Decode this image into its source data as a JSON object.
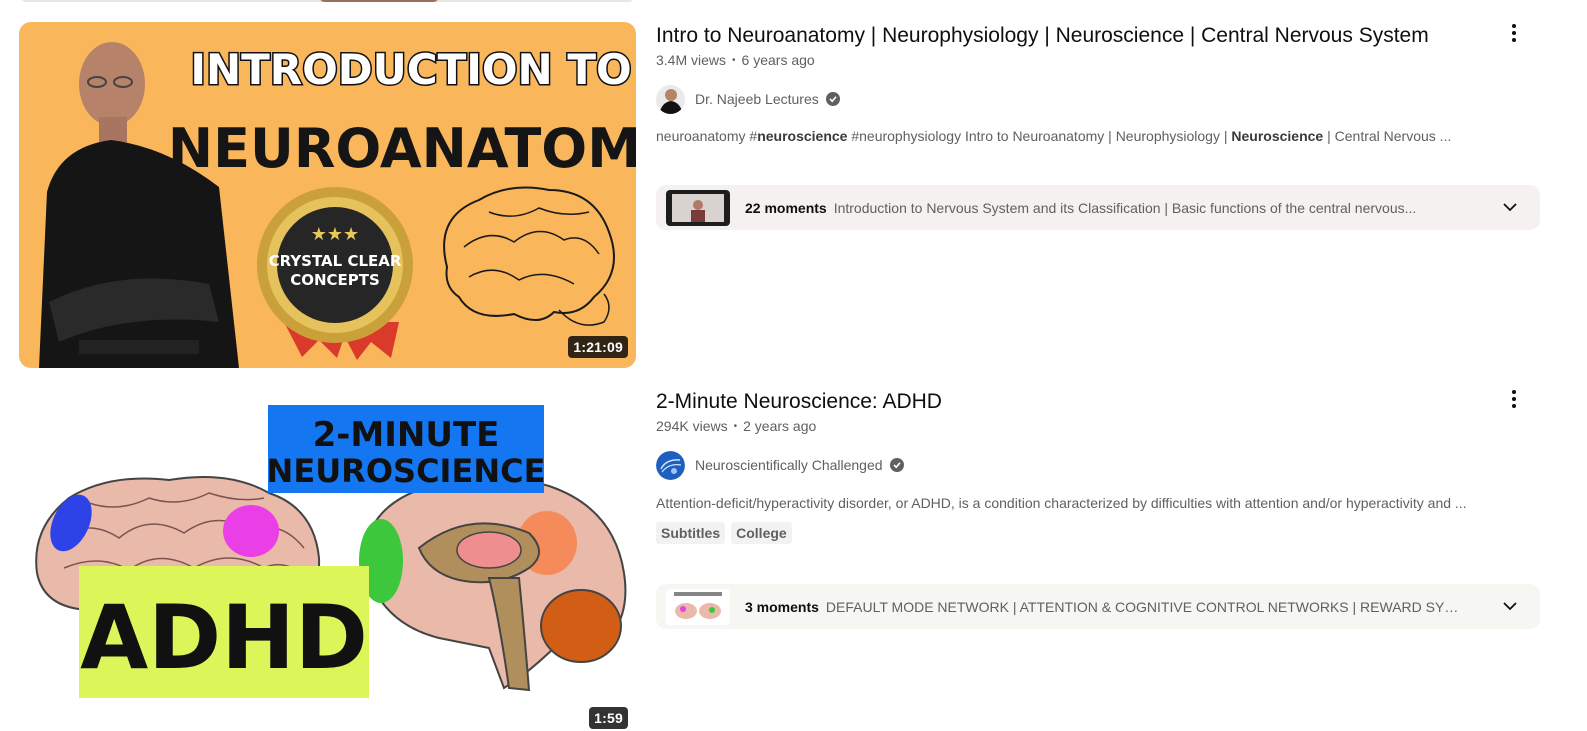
{
  "results": [
    {
      "title": "Intro to Neuroanatomy | Neurophysiology | Neuroscience | Central Nervous System",
      "views": "3.4M views",
      "age": "6 years ago",
      "channel": "Dr. Najeeb Lectures",
      "duration": "1:21:09",
      "description": [
        {
          "text": "neuroanatomy #",
          "bold": false
        },
        {
          "text": "neuroscience",
          "bold": true
        },
        {
          "text": " #neurophysiology Intro to Neuroanatomy | Neurophysiology | ",
          "bold": false
        },
        {
          "text": "Neuroscience",
          "bold": true
        },
        {
          "text": " | Central Nervous ...",
          "bold": false
        }
      ],
      "badges": [],
      "moments_count": "22 moments",
      "moments_text": "Introduction to Nervous System and its Classification | Basic functions of the central nervous...",
      "thumb_text": {
        "line1": "INTRODUCTION TO",
        "line2": "NEUROANATOMY",
        "seal1": "CRYSTAL CLEAR",
        "seal2": "CONCEPTS"
      }
    },
    {
      "title": "2-Minute Neuroscience: ADHD",
      "views": "294K views",
      "age": "2 years ago",
      "channel": "Neuroscientifically Challenged",
      "duration": "1:59",
      "description": [
        {
          "text": "Attention-deficit/hyperactivity disorder, or ADHD, is a condition characterized by difficulties with attention and/or hyperactivity and ...",
          "bold": false
        }
      ],
      "badges": [
        "Subtitles",
        "College"
      ],
      "moments_count": "3 moments",
      "moments_text": "DEFAULT MODE NETWORK | ATTENTION & COGNITIVE CONTROL NETWORKS | REWARD SYSTEM",
      "thumb_text": {
        "banner1": "2-MINUTE",
        "banner2": "NEUROSCIENCE",
        "main": "ADHD"
      }
    }
  ],
  "colors": {
    "thumb1_bg": "#f9b65a",
    "thumb2_banner": "#1476f0",
    "thumb2_label": "#dcf65a"
  }
}
